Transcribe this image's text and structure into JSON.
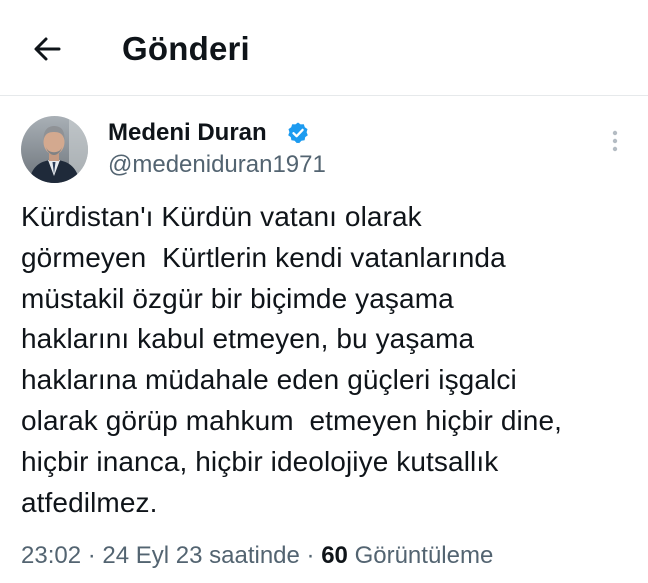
{
  "header": {
    "title": "Gönderi",
    "back_icon": "arrow-left-icon"
  },
  "author": {
    "display_name": "Medeni Duran",
    "handle": "@medeniduran1971",
    "verified_icon": "verified-badge-icon",
    "more_icon": "more-vertical-icon"
  },
  "tweet": {
    "text": "Kürdistan'ı Kürdün vatanı olarak\ngörmeyen  Kürtlerin kendi vatanlarında\nmüstakil özgür bir biçimde yaşama\nhaklarını kabul etmeyen, bu yaşama\nhaklarına müdahale eden güçleri işgalci\nolarak görüp mahkum  etmeyen hiçbir dine,\nhiçbir inanca, hiçbir ideolojiye kutsallık\natfedilmez."
  },
  "meta": {
    "time": "23:02",
    "sep1": " · ",
    "date": "24 Eyl 23 saatinde",
    "sep2": " · ",
    "views_count": "60",
    "views_label": " Görüntüleme"
  },
  "colors": {
    "text_primary": "#0f1419",
    "text_secondary": "#536471",
    "verified_blue": "#1d9bf0",
    "divider": "#e6e9eb"
  }
}
